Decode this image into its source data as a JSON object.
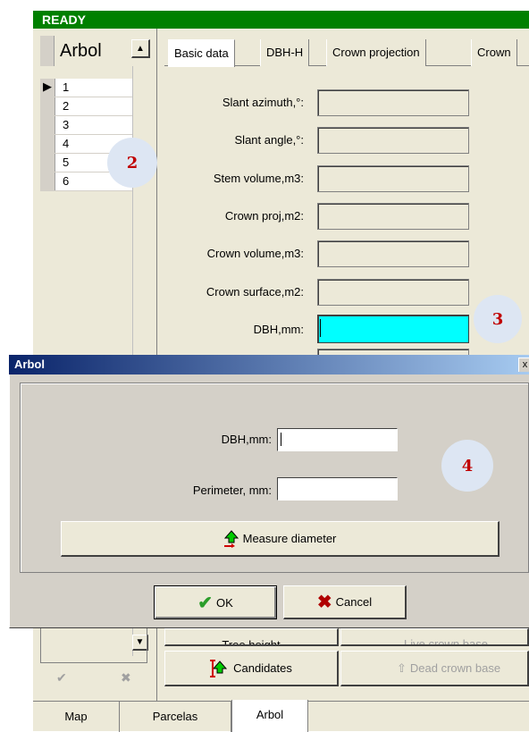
{
  "status": "READY",
  "grid": {
    "header": "Arbol",
    "rows": [
      "1",
      "2",
      "3",
      "4",
      "5",
      "6"
    ]
  },
  "tabs": [
    "Basic data",
    "DBH-H",
    "Crown projection",
    "Crown"
  ],
  "fields": [
    {
      "label": "Slant azimuth,°:"
    },
    {
      "label": "Slant angle,°:"
    },
    {
      "label": "Stem volume,m3:"
    },
    {
      "label": "Crown proj,m2:"
    },
    {
      "label": "Crown volume,m3:"
    },
    {
      "label": "Crown surface,m2:"
    },
    {
      "label": "DBH,mm:"
    }
  ],
  "badges": {
    "b2": "2",
    "b3": "3",
    "b4": "4"
  },
  "dialog": {
    "title": "Arbol",
    "close": "x",
    "dbh_label": "DBH,mm:",
    "perimeter_label": "Perimeter, mm:",
    "measure_label": "Measure diameter",
    "ok_label": "OK",
    "cancel_label": "Cancel"
  },
  "bottom": {
    "tree_height": "Tree height",
    "live_crown": "Live crown base",
    "candidates": "Candidates",
    "dead_crown": "Dead crown base"
  },
  "bottom_tabs": [
    "Map",
    "Parcelas",
    "Arbol"
  ],
  "colors": {
    "status_bg": "#008000",
    "highlight": "#00ffff",
    "title_start": "#0a246a"
  }
}
